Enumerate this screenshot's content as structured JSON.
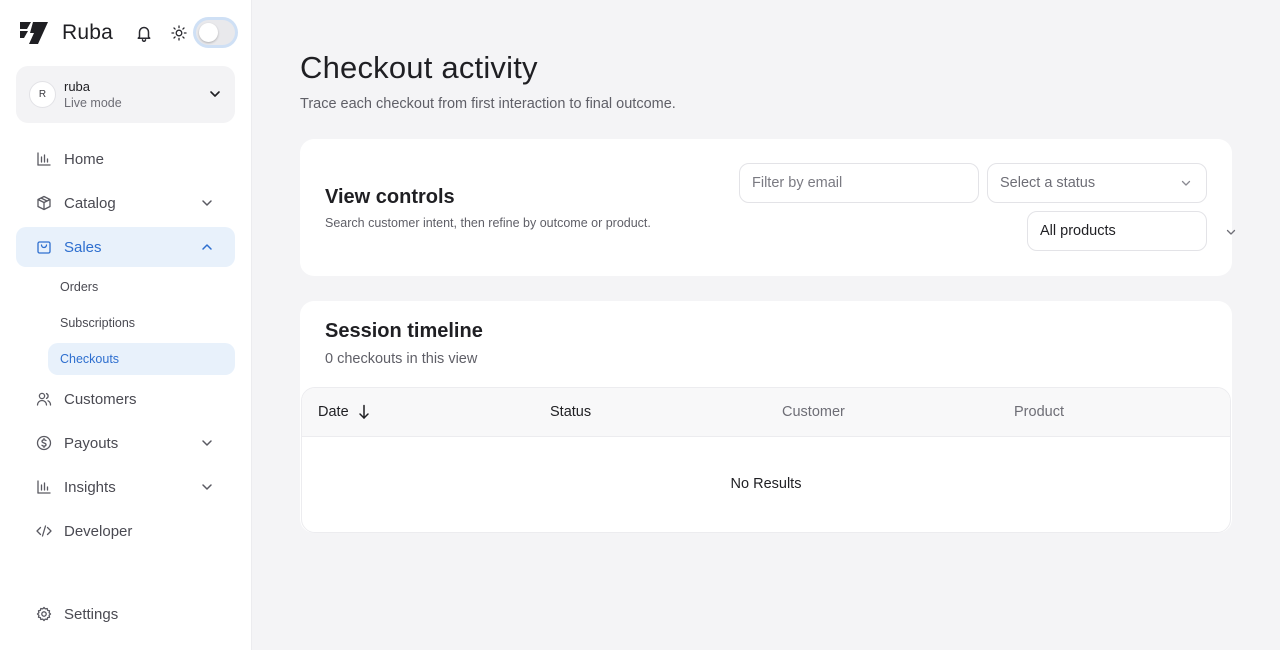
{
  "brand": {
    "name": "Ruba",
    "logo_icon": "ruba-logo-icon"
  },
  "header": {
    "bell_icon": "bell-icon",
    "theme_icon": "sun-icon",
    "theme_toggle_on": false
  },
  "org": {
    "avatar_initial": "R",
    "name": "ruba",
    "mode": "Live mode"
  },
  "sidebar": {
    "items": [
      {
        "label": "Home",
        "icon": "bar-chart-icon"
      },
      {
        "label": "Catalog",
        "icon": "package-icon",
        "expandable": true
      },
      {
        "label": "Sales",
        "icon": "shopping-bag-icon",
        "expandable": true,
        "active": true
      },
      {
        "label": "Customers",
        "icon": "users-icon"
      },
      {
        "label": "Payouts",
        "icon": "dollar-circle-icon",
        "expandable": true
      },
      {
        "label": "Insights",
        "icon": "bar-chart-icon",
        "expandable": true
      },
      {
        "label": "Developer",
        "icon": "code-icon"
      },
      {
        "label": "Settings",
        "icon": "gear-icon"
      }
    ],
    "sales_subitems": [
      {
        "label": "Orders"
      },
      {
        "label": "Subscriptions"
      },
      {
        "label": "Checkouts",
        "active": true
      }
    ]
  },
  "main": {
    "title": "Checkout activity",
    "subtitle": "Trace each checkout from first interaction to final outcome."
  },
  "controls": {
    "title": "View controls",
    "subtitle": "Search customer intent, then refine by outcome or product.",
    "email_placeholder": "Filter by email",
    "email_value": "",
    "status_placeholder": "Select a status",
    "product_value": "All products"
  },
  "timeline": {
    "title": "Session timeline",
    "count_text": "0 checkouts in this view",
    "columns": [
      "Date",
      "Status",
      "Customer",
      "Product"
    ],
    "sort_column": "Date",
    "sort_direction": "descending",
    "empty_text": "No Results",
    "rows": []
  },
  "colors": {
    "accent": "#2e6fcf",
    "active_bg": "#e8f1fb",
    "page_bg": "#f4f4f6"
  }
}
